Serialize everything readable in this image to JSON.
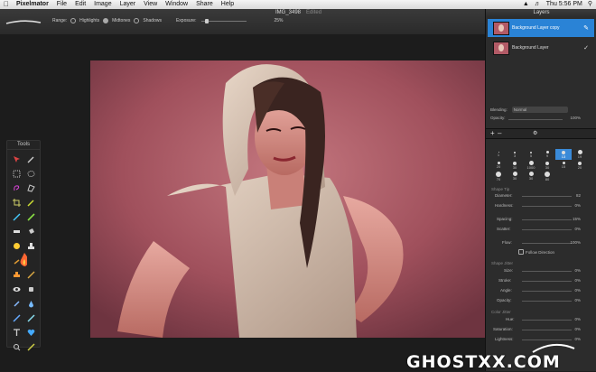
{
  "menubar": {
    "app": "Pixelmator",
    "items": [
      "File",
      "Edit",
      "Image",
      "Layer",
      "View",
      "Window",
      "Share",
      "Help"
    ],
    "clock": "Thu 5:56 PM"
  },
  "document": {
    "title": "IMG_3498",
    "status": "Edited"
  },
  "tool_options": {
    "range_label": "Range:",
    "range_options": [
      "Highlights",
      "Midtones",
      "Shadows"
    ],
    "range_selected": "Midtones",
    "exposure_label": "Exposure:",
    "exposure_value": "25%"
  },
  "tools_panel": {
    "title": "Tools"
  },
  "layers_panel": {
    "title": "Layers",
    "layers": [
      {
        "name": "Background Layer copy",
        "selected": true
      },
      {
        "name": "Background Layer",
        "selected": false
      }
    ],
    "blending_label": "Blending:",
    "blending_value": "Normal",
    "opacity_label": "Opacity:",
    "opacity_value": "100%"
  },
  "brushes": {
    "sizes": [
      "1",
      "3",
      "5",
      "9",
      "13",
      "19",
      "5",
      "9",
      "13",
      "17",
      "21",
      "27",
      "35",
      "45",
      "65",
      "100",
      "200",
      "300"
    ],
    "row1": [
      "1",
      "3",
      "5",
      "9",
      "13",
      "19"
    ],
    "row2": [
      "5",
      "9",
      "13",
      "17",
      "21",
      "27"
    ],
    "row3": [
      "20",
      "30",
      "1000",
      "30",
      "15",
      "20"
    ],
    "row4": [
      "70",
      "30",
      "30",
      "80",
      "",
      ""
    ]
  },
  "brush_settings": {
    "shape_tip": "Shape Tip",
    "diameter_label": "Diameter:",
    "diameter_value": "82",
    "hardness_label": "Hardness:",
    "hardness_value": "0%",
    "spacing_label": "Spacing:",
    "spacing_value": "15%",
    "scatter_label": "Scatter:",
    "scatter_value": "0%",
    "flow_label": "Flow:",
    "flow_value": "100%",
    "follow_direction": "Follow Direction",
    "shape_jitter": "Shape Jitter",
    "size_label": "Size:",
    "size_value": "0%",
    "stroke_label": "Stroke:",
    "stroke_value": "0%",
    "angle_label": "Angle:",
    "angle_value": "0%",
    "opacity_label": "Opacity:",
    "opacity_value": "0%",
    "color_jitter": "Color Jitter",
    "hue_label": "Hue:",
    "hue_value": "0%",
    "saturation_label": "Saturation:",
    "saturation_value": "0%",
    "lightness_label": "Lightness:",
    "lightness_value": "0%"
  },
  "watermark": "GHOSTXX.COM",
  "colors": {
    "accent": "#2a83d6",
    "photo_tint": "#b8646f"
  }
}
